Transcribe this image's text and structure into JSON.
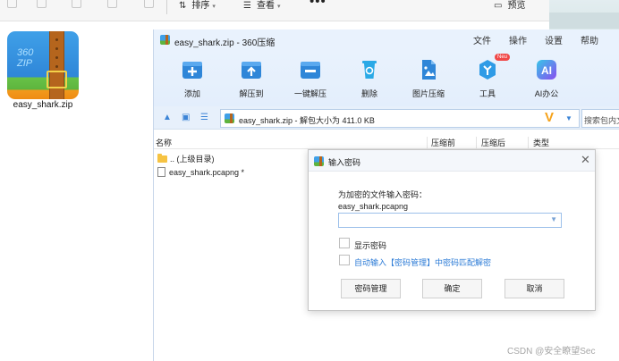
{
  "explorer": {
    "sort_label": "排序",
    "view_label": "查看",
    "more_label": "•••",
    "preview_label": "预览"
  },
  "desktop": {
    "file_label": "easy_shark.zip",
    "icon_text": "360\nZIP"
  },
  "window": {
    "title": "easy_shark.zip - 360压缩",
    "menus": [
      "文件",
      "操作",
      "设置",
      "帮助"
    ]
  },
  "toolbar": {
    "items": [
      {
        "label": "添加",
        "icon": "add-icon",
        "color": "#2f86d8"
      },
      {
        "label": "解压到",
        "icon": "extract-to-icon",
        "color": "#2f86d8"
      },
      {
        "label": "一键解压",
        "icon": "one-click-extract-icon",
        "color": "#2f86d8"
      },
      {
        "label": "删除",
        "icon": "recycle-bin-icon",
        "color": "#2aa9e6"
      },
      {
        "label": "图片压缩",
        "icon": "image-compress-icon",
        "color": "#2f86d8"
      },
      {
        "label": "工具",
        "icon": "tools-icon",
        "color": "#2f9be6",
        "badge": "Neu"
      },
      {
        "label": "AI办公",
        "icon": "ai-office-icon",
        "color": "#5a6ee8"
      }
    ]
  },
  "address": {
    "text": "easy_shark.zip - 解包大小为 411.0 KB",
    "search_placeholder": "搜索包内文"
  },
  "columns": {
    "name": "名称",
    "packed": "压缩前",
    "unpacked": "压缩后",
    "type": "类型"
  },
  "files": [
    {
      "name": ".. (上级目录)",
      "kind": "folder"
    },
    {
      "name": "easy_shark.pcapng *",
      "kind": "file"
    }
  ],
  "dialog": {
    "title": "输入密码",
    "prompt": "为加密的文件输入密码：",
    "filename": "easy_shark.pcapng",
    "password_value": "",
    "show_password_label": "显示密码",
    "auto_fill_label": "自动输入【密码管理】中密码匹配解密",
    "buttons": {
      "manage": "密码管理",
      "ok": "确定",
      "cancel": "取消"
    }
  },
  "watermark": "CSDN @安全瞭望Sec",
  "colors": {
    "accent": "#2f86d8",
    "toolbar_bg": "#e9f2fd",
    "link_blue": "#2a7ad6",
    "brand_orange": "#f6a21a"
  }
}
